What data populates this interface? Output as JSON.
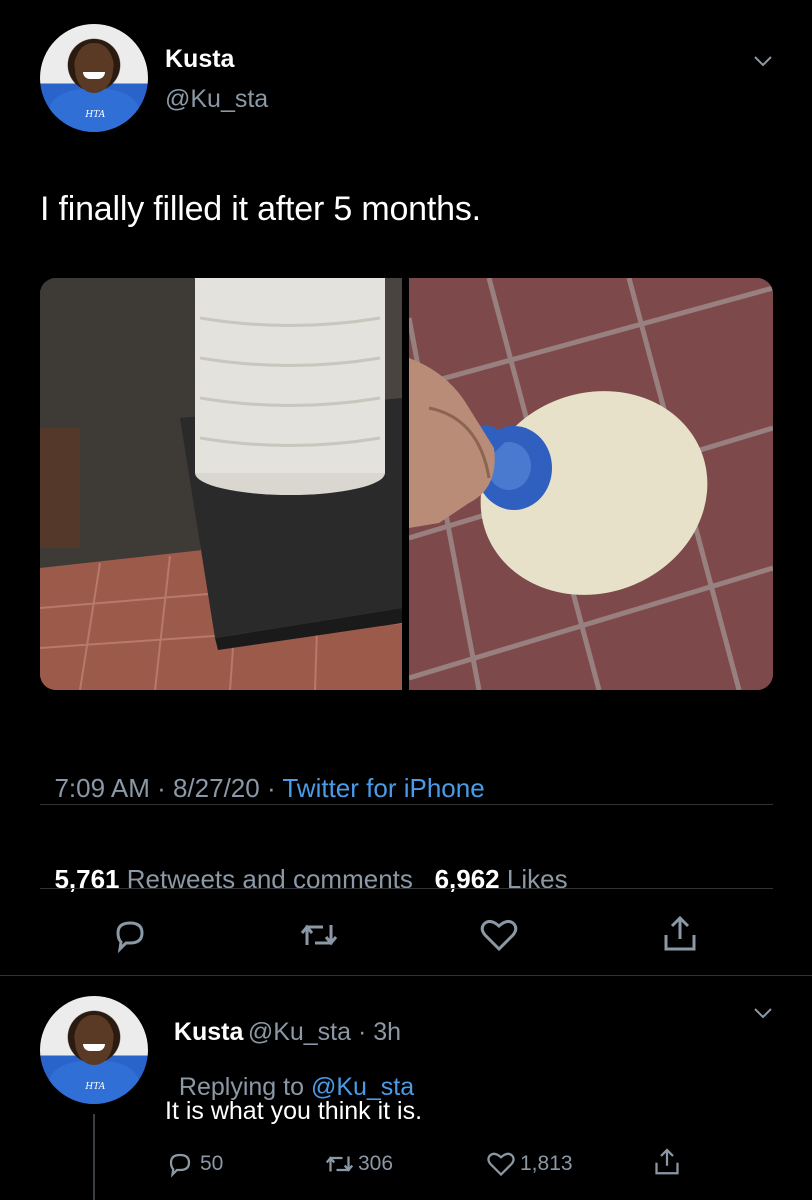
{
  "tweet": {
    "author": {
      "name": "Kusta",
      "handle": "@Ku_sta"
    },
    "text": "I finally filled it after 5 months.",
    "meta": {
      "time": "7:09 AM",
      "sep1": " · ",
      "date": "8/27/20",
      "sep2": " · ",
      "source": "Twitter for iPhone"
    },
    "stats": {
      "retweets_count": "5,761",
      "retweets_label": "Retweets and comments",
      "likes_count": "6,962",
      "likes_label": "Likes"
    },
    "media": [
      {
        "alt": "large white plastic bottle on a table"
      },
      {
        "alt": "hand holding white bottle with blue cap over tiles"
      }
    ]
  },
  "reply": {
    "author": {
      "name": "Kusta",
      "handle": "@Ku_sta",
      "time": "3h"
    },
    "replying_prefix": "Replying to",
    "replying_to": "@Ku_sta",
    "text": "It is what you think it is.",
    "counts": {
      "replies": "50",
      "retweets": "306",
      "likes": "1,813"
    }
  },
  "colors": {
    "background": "#000000",
    "muted": "#8b98a5",
    "link": "#4a9be8"
  }
}
